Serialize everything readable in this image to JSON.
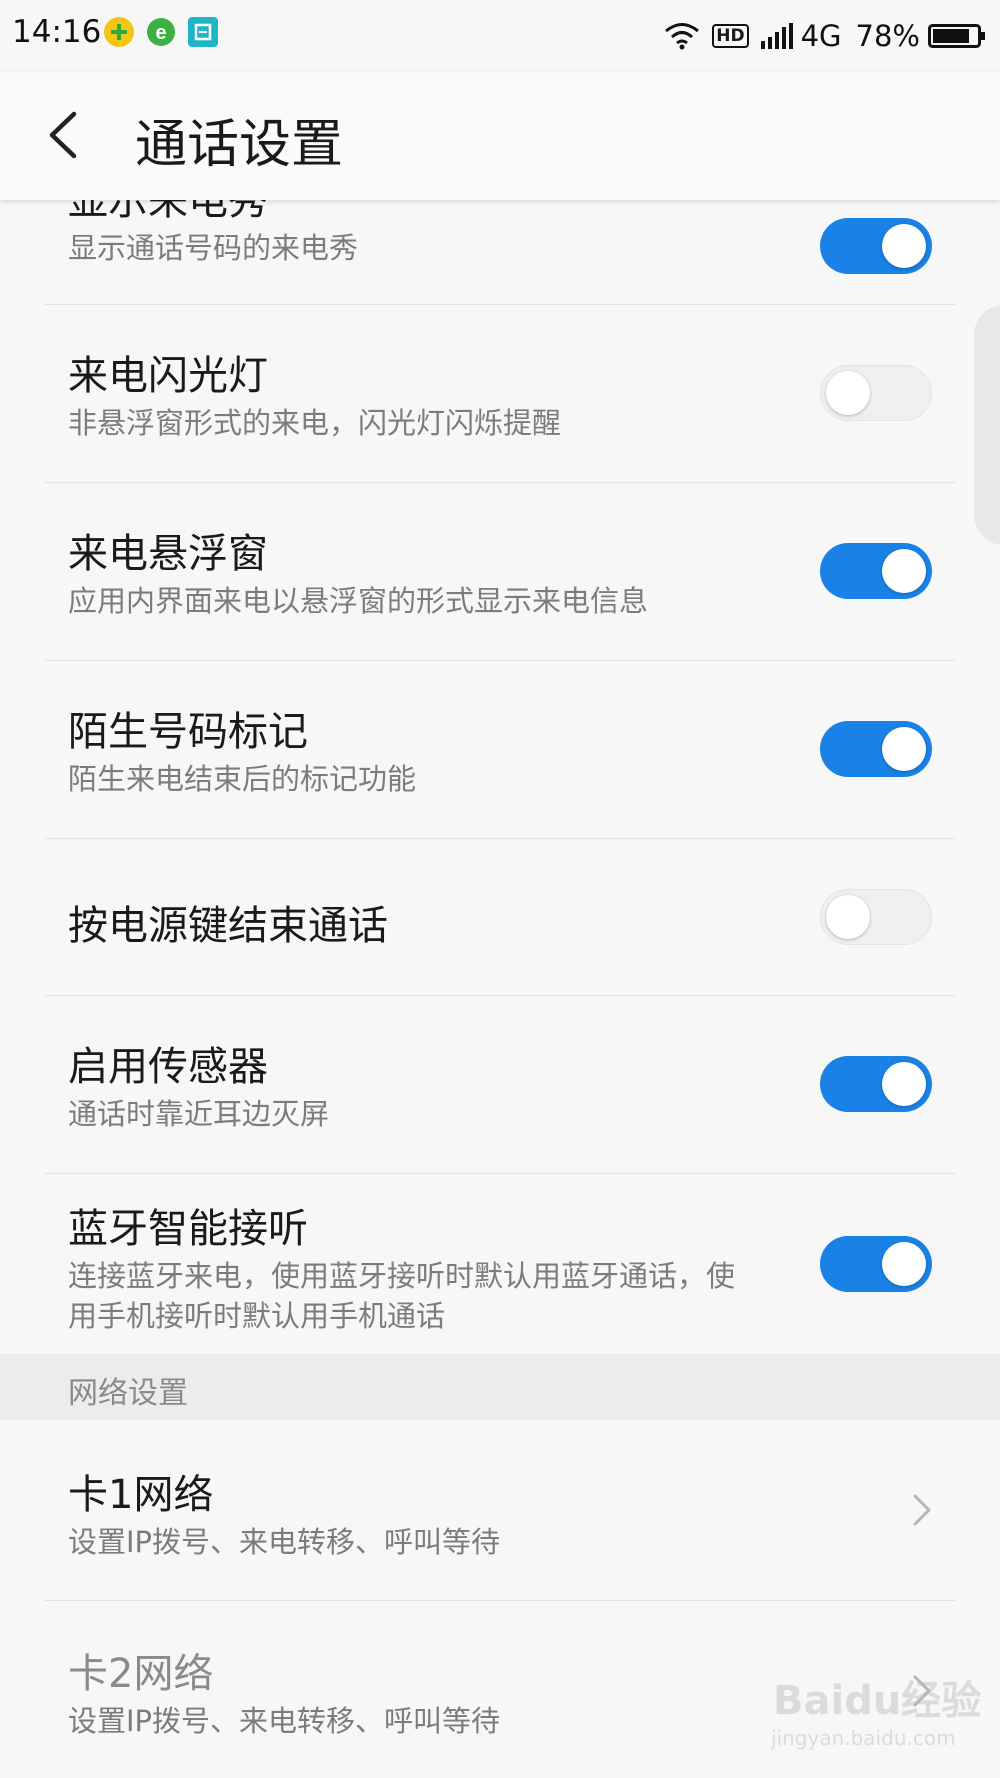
{
  "status_bar": {
    "time": "14:16",
    "network": "4G",
    "battery": "78%",
    "hd_label": "HD"
  },
  "header": {
    "title": "通话设置"
  },
  "settings": [
    {
      "title": "显示来电秀",
      "subtitle": "显示通话号码的来电秀",
      "enabled": true
    },
    {
      "title": "来电闪光灯",
      "subtitle": "非悬浮窗形式的来电，闪光灯闪烁提醒",
      "enabled": false
    },
    {
      "title": "来电悬浮窗",
      "subtitle": "应用内界面来电以悬浮窗的形式显示来电信息",
      "enabled": true
    },
    {
      "title": "陌生号码标记",
      "subtitle": "陌生来电结束后的标记功能",
      "enabled": true
    },
    {
      "title": "按电源键结束通话",
      "subtitle": "",
      "enabled": false
    },
    {
      "title": "启用传感器",
      "subtitle": "通话时靠近耳边灭屏",
      "enabled": true
    },
    {
      "title": "蓝牙智能接听",
      "subtitle": "连接蓝牙来电，使用蓝牙接听时默认用蓝牙通话，使用手机接听时默认用手机通话",
      "enabled": true
    }
  ],
  "network_section": {
    "header": "网络设置",
    "items": [
      {
        "title": "卡1网络",
        "subtitle": "设置IP拨号、来电转移、呼叫等待"
      },
      {
        "title": "卡2网络",
        "subtitle": "设置IP拨号、来电转移、呼叫等待"
      }
    ]
  },
  "watermark": {
    "text": "Baidu经验",
    "url": "jingyan.baidu.com"
  },
  "colors": {
    "toggle_on": "#1a82e6",
    "toggle_off": "#efefef",
    "accent_green": "#3cb043"
  }
}
